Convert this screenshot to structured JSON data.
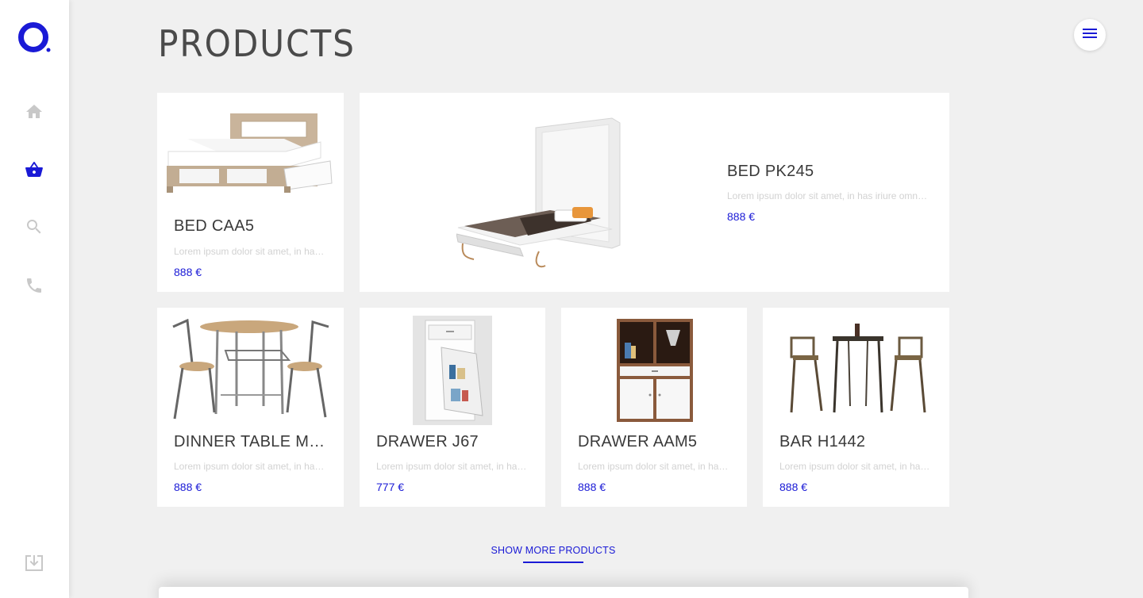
{
  "header": {
    "title": "PRODUCTS"
  },
  "sidebar": {
    "items": [
      {
        "name": "home",
        "icon": "home-icon",
        "active": false
      },
      {
        "name": "products",
        "icon": "basket-icon",
        "active": true
      },
      {
        "name": "search",
        "icon": "search-icon",
        "active": false
      },
      {
        "name": "contact",
        "icon": "phone-icon",
        "active": false
      }
    ],
    "download_icon": "download-icon"
  },
  "products": [
    {
      "name": "BED CAA5",
      "description": "Lorem ipsum dolor sit amet, in has iriure omnesque",
      "price": "888 €",
      "image": "bed-image"
    },
    {
      "name": "BED PK245",
      "description": "Lorem ipsum dolor sit amet, in has iriure omnesque",
      "price": "888 €",
      "image": "wall-bed-image"
    },
    {
      "name": "DINNER TABLE MALAGA",
      "description": "Lorem ipsum dolor sit amet, in has iriure omnesque",
      "price": "888 €",
      "image": "dinner-table-image"
    },
    {
      "name": "DRAWER J67",
      "description": "Lorem ipsum dolor sit amet, in has iriure omnesque",
      "price": "777 €",
      "image": "drawer-image"
    },
    {
      "name": "DRAWER AAM5",
      "description": "Lorem ipsum dolor sit amet, in has iriure omnesque",
      "price": "888 €",
      "image": "cabinet-image"
    },
    {
      "name": "BAR H1442",
      "description": "Lorem ipsum dolor sit amet, in has iriure omnesque",
      "price": "888 €",
      "image": "bar-set-image"
    }
  ],
  "show_more_label": "SHOW MORE PRODUCTS",
  "colors": {
    "accent": "#1a1ad6",
    "background": "#f0f0f0",
    "muted_icon": "#c8c8c8"
  }
}
